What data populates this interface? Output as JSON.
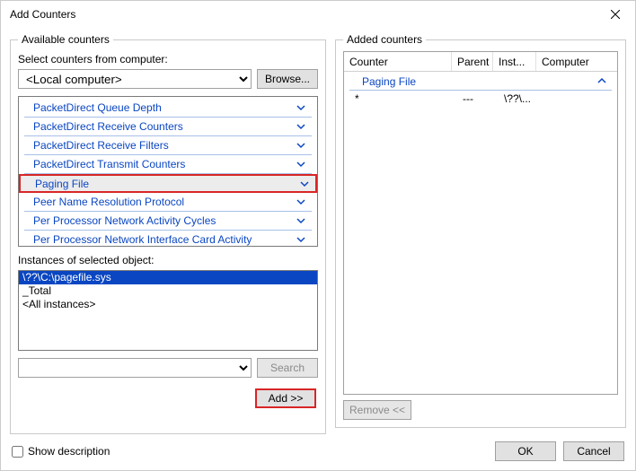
{
  "window": {
    "title": "Add Counters"
  },
  "left": {
    "groupbox_title": "Available counters",
    "select_label": "Select counters from computer:",
    "computer_value": "<Local computer>",
    "browse_label": "Browse...",
    "counters": [
      "PacketDirect Queue Depth",
      "PacketDirect Receive Counters",
      "PacketDirect Receive Filters",
      "PacketDirect Transmit Counters",
      "Paging File",
      "Peer Name Resolution Protocol",
      "Per Processor Network Activity Cycles",
      "Per Processor Network Interface Card Activity"
    ],
    "highlight_index": 4,
    "instances_label": "Instances of selected object:",
    "instances": [
      "\\??\\C:\\pagefile.sys",
      "_Total",
      "<All instances>"
    ],
    "selected_instance_index": 0,
    "search_label": "Search",
    "search_value": "",
    "add_label": "Add >>"
  },
  "right": {
    "groupbox_title": "Added counters",
    "columns": {
      "counter": "Counter",
      "parent": "Parent",
      "inst": "Inst...",
      "computer": "Computer"
    },
    "group_name": "Paging File",
    "rows": [
      {
        "counter": "*",
        "parent": "---",
        "inst": "\\??\\...",
        "computer": ""
      }
    ],
    "remove_label": "Remove <<"
  },
  "footer": {
    "show_description_label": "Show description",
    "ok_label": "OK",
    "cancel_label": "Cancel"
  }
}
